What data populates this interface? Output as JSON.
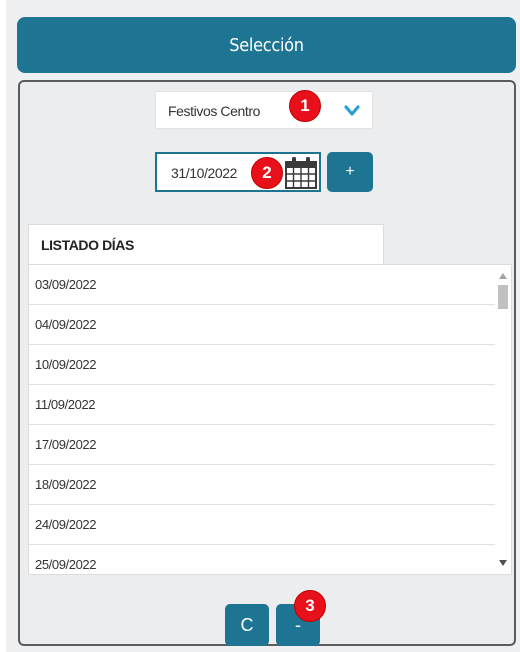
{
  "header": {
    "title": "Selección"
  },
  "calendar_select": {
    "value": "Festivos Centro"
  },
  "date_field": {
    "value": "31/10/2022"
  },
  "add_button": {
    "label": "+"
  },
  "list": {
    "header": "LISTADO DÍAS",
    "items": [
      "03/09/2022",
      "04/09/2022",
      "10/09/2022",
      "11/09/2022",
      "17/09/2022",
      "18/09/2022",
      "24/09/2022",
      "25/09/2022"
    ]
  },
  "bottom": {
    "clear_label": "C",
    "remove_label": "-"
  },
  "badges": [
    "1",
    "2",
    "3"
  ],
  "colors": {
    "accent": "#1e7593",
    "badge": "#e8101a"
  },
  "icons": {
    "dropdown": "chevron-down-icon",
    "calendar": "calendar-icon"
  }
}
